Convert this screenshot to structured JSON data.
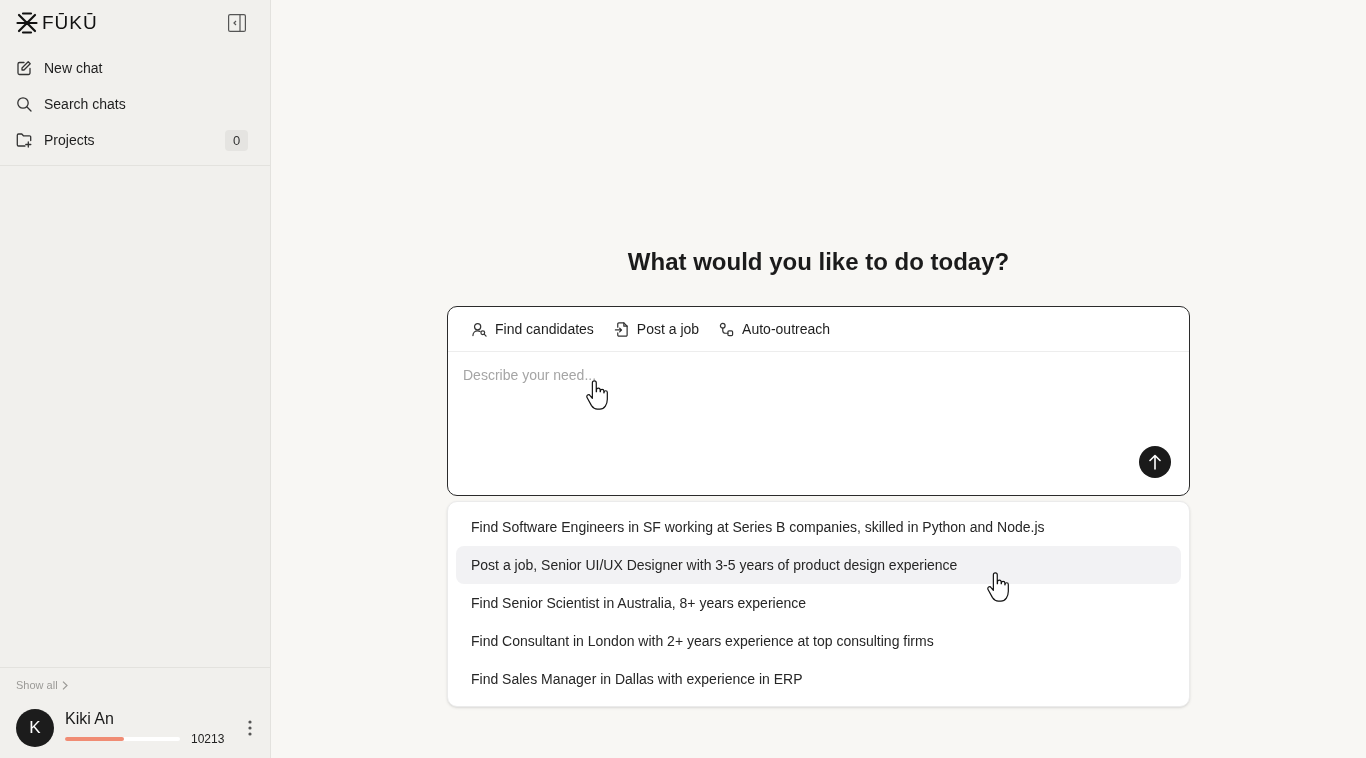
{
  "sidebar": {
    "logo": "FŪKŪ",
    "nav": [
      {
        "kind": "new_chat",
        "label": "New chat"
      },
      {
        "kind": "search",
        "label": "Search chats"
      },
      {
        "kind": "projects",
        "label": "Projects",
        "count": "0"
      }
    ],
    "show_all": "Show all",
    "user": {
      "initial": "K",
      "name": "Kiki An",
      "level": 0.51,
      "credits": "10213"
    }
  },
  "main": {
    "heading": "What would you like to do today?",
    "composer": {
      "tabs": [
        {
          "kind": "find",
          "label": "Find candidates"
        },
        {
          "kind": "post",
          "label": "Post a job"
        },
        {
          "kind": "outreach",
          "label": "Auto-outreach"
        }
      ],
      "placeholder": "Describe your need..."
    },
    "suggestions": [
      {
        "text": "Find Software Engineers in SF working at Series B companies, skilled in Python and Node.js",
        "highlighted": false
      },
      {
        "text": "Post a job, Senior UI/UX Designer with 3-5 years of product design experience",
        "highlighted": true
      },
      {
        "text": "Find Senior Scientist in Australia, 8+ years experience",
        "highlighted": false
      },
      {
        "text": "Find Consultant in London with 2+ years experience at top consulting firms",
        "highlighted": false
      },
      {
        "text": "Find Sales Manager in Dallas with experience in ERP",
        "highlighted": false
      }
    ]
  }
}
